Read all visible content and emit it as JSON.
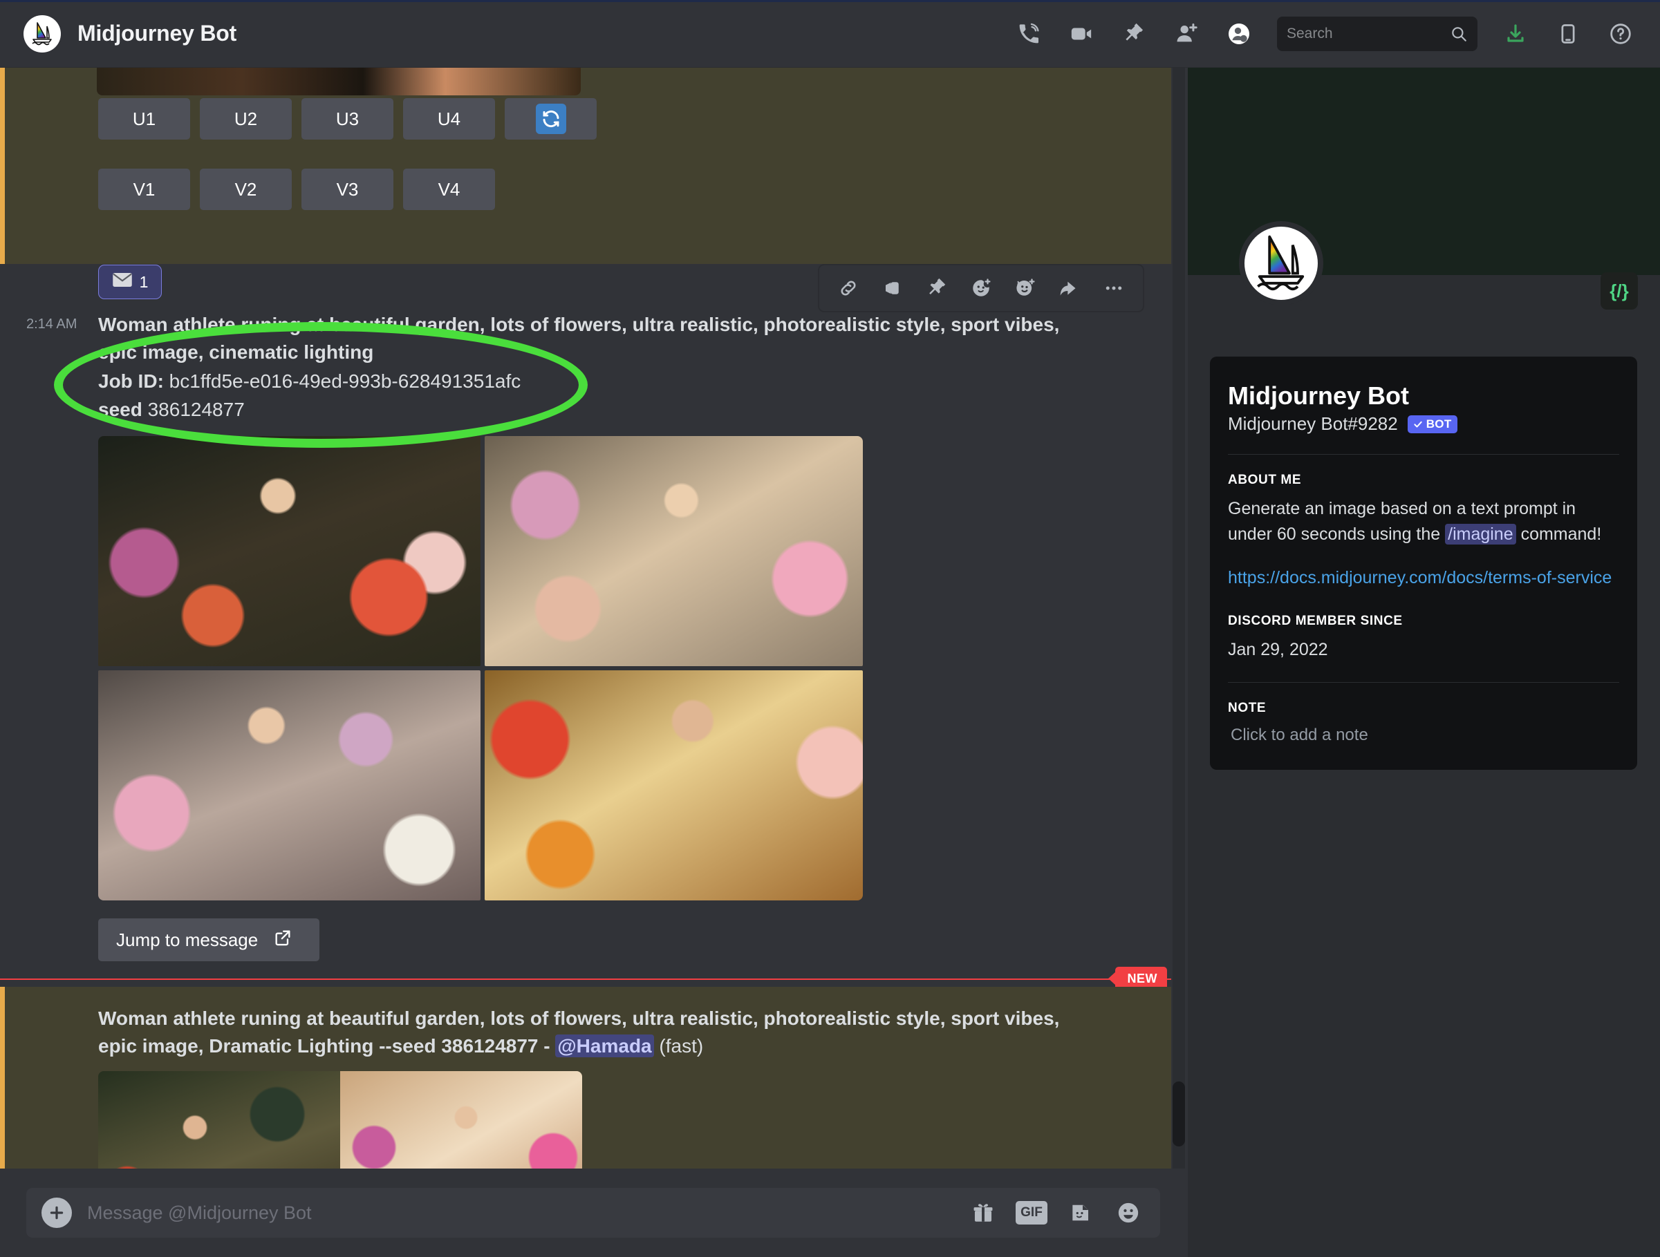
{
  "window": {
    "dm_title": "Midjourney Bot"
  },
  "topbar": {
    "icons": [
      {
        "name": "voice-call-icon",
        "label": "Start Voice Call"
      },
      {
        "name": "video-call-icon",
        "label": "Start Video Call"
      },
      {
        "name": "pinned-messages-icon",
        "label": "Pinned Messages"
      },
      {
        "name": "add-friends-icon",
        "label": "Add Friends to DM"
      },
      {
        "name": "hide-member-list-icon",
        "label": "Hide User Profile"
      }
    ],
    "search": {
      "placeholder": "Search",
      "value": ""
    },
    "right_icons": [
      {
        "name": "inbox-download-icon",
        "label": "Inbox"
      },
      {
        "name": "mobile-app-icon",
        "label": "Get the mobile app"
      },
      {
        "name": "help-icon",
        "label": "Help"
      }
    ]
  },
  "message_top": {
    "upscale_buttons": [
      "U1",
      "U2",
      "U3",
      "U4"
    ],
    "variation_buttons": [
      "V1",
      "V2",
      "V3",
      "V4"
    ],
    "refresh_button": "refresh-icon",
    "reaction": {
      "icon": "envelope-icon",
      "count": "1"
    }
  },
  "hover_toolbar": [
    {
      "name": "copy-link-icon"
    },
    {
      "name": "mark-unread-icon"
    },
    {
      "name": "pin-message-icon"
    },
    {
      "name": "add-reaction-icon"
    },
    {
      "name": "add-super-reaction-icon"
    },
    {
      "name": "reply-icon"
    },
    {
      "name": "more-options-icon"
    }
  ],
  "message_reply": {
    "timestamp": "2:14 AM",
    "prompt": "Woman athlete runing at beautiful garden, lots of flowers, ultra realistic, photorealistic style, sport vibes, epic image, cinematic lighting",
    "job_id_label": "Job ID",
    "job_id_value": "bc1ffd5e-e016-49ed-993b-628491351afc",
    "seed_label": "seed",
    "seed_value": "386124877",
    "jump_button": "Jump to message",
    "jump_icon": "external-link-icon",
    "images": [
      {
        "alt": "Upscale 1 — woman running in dark flower garden"
      },
      {
        "alt": "Upscale 2 — woman running in sunlit greenhouse"
      },
      {
        "alt": "Upscale 3 — woman running among pastel flowers"
      },
      {
        "alt": "Upscale 4 — woman running in golden light"
      }
    ]
  },
  "new_divider": {
    "label": "NEW"
  },
  "message_last": {
    "prompt_part1": "Woman athlete runing at beautiful garden, lots of flowers, ultra realistic, photorealistic style, sport vibes, epic image, Dramatic Lighting --seed 386124877 - ",
    "mention": "@Hamada",
    "suffix": " (fast)",
    "images": [
      {
        "alt": "Grid preview 1 — woman running under garden arch"
      },
      {
        "alt": "Grid preview 2 — woman running with falling petals"
      }
    ]
  },
  "composer": {
    "placeholder": "Message @Midjourney Bot",
    "value": "",
    "add_icon": "plus-icon",
    "icons": [
      {
        "name": "gift-icon"
      },
      {
        "name": "gif-icon",
        "label": "GIF"
      },
      {
        "name": "sticker-icon"
      },
      {
        "name": "emoji-icon"
      }
    ]
  },
  "member_panel": {
    "slash_button": "{/}",
    "display_name": "Midjourney Bot",
    "username_tag": "Midjourney Bot#9282",
    "bot_badge": "BOT",
    "about_heading": "ABOUT ME",
    "about_text_1": "Generate an image based on a text prompt in under 60 seconds using the ",
    "about_command": "/imagine",
    "about_text_2": " command!",
    "terms_link": "https://docs.midjourney.com/docs/terms-of-service",
    "member_since_heading": "DISCORD MEMBER SINCE",
    "member_since_value": "Jan 29, 2022",
    "note_heading": "NOTE",
    "note_placeholder": "Click to add a note"
  },
  "annotation": {
    "type": "green-ellipse-highlight",
    "color": "#4ade3c"
  },
  "colors": {
    "chat_bg": "#313338",
    "panel_bg": "#2b2d31",
    "card_bg": "#111214",
    "mention_bg": "#43412f",
    "mention_bar": "#e7ab4b",
    "blurple": "#5865f2",
    "new_red": "#f23f43",
    "link_blue": "#4aa3e8",
    "banner_green": "#18231d",
    "annotation_green": "#4ade3c"
  }
}
